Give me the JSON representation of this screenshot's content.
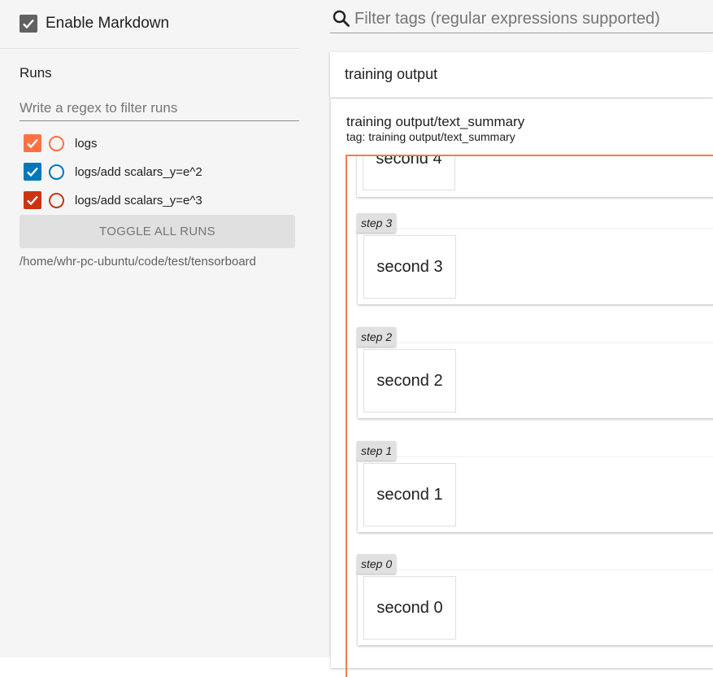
{
  "sidebar": {
    "enable_markdown": {
      "label": "Enable Markdown",
      "checked": true
    },
    "runs_title": "Runs",
    "runs_filter_placeholder": "Write a regex to filter runs",
    "runs": [
      {
        "label": "logs",
        "checked": true,
        "color": "#ff7043"
      },
      {
        "label": "logs/add scalars_y=e^2",
        "checked": true,
        "color": "#0077bb"
      },
      {
        "label": "logs/add scalars_y=e^3",
        "checked": true,
        "color": "#cc3311"
      }
    ],
    "toggle_all_label": "TOGGLE ALL RUNS",
    "logdir": "/home/whr-pc-ubuntu/code/test/tensorboard"
  },
  "main": {
    "tag_filter_placeholder": "Filter tags (regular expressions supported)",
    "category_title": "training output",
    "card": {
      "title": "training output/text_summary",
      "tag_line": "tag: training output/text_summary",
      "accent_color": "#f57c4a",
      "partial_top_text": "second 4",
      "steps": [
        {
          "step": "step 3",
          "text": "second 3"
        },
        {
          "step": "step 2",
          "text": "second 2"
        },
        {
          "step": "step 1",
          "text": "second 1"
        },
        {
          "step": "step 0",
          "text": "second 0"
        }
      ]
    }
  }
}
